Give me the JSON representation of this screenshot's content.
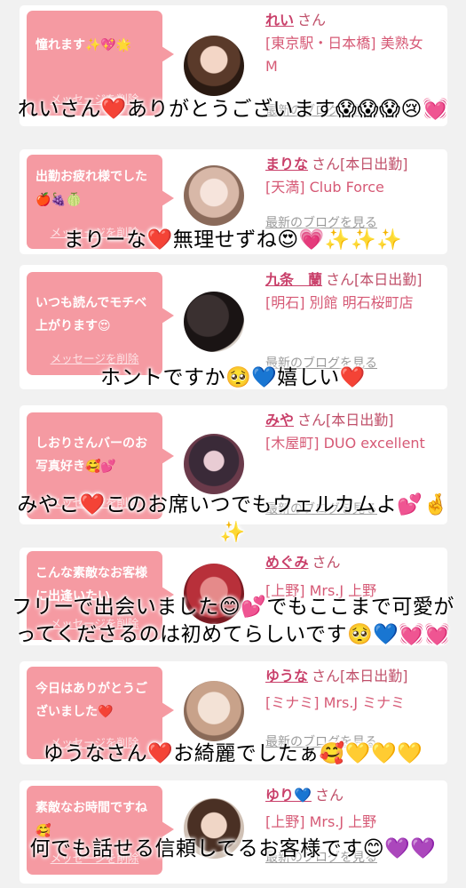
{
  "delete_label": "メッセージを削除",
  "blog_label": "最新のブログを見る",
  "honorific": "さん",
  "cards": [
    {
      "message": "憧れます✨💖🌟",
      "cast": "れい",
      "today": "",
      "shop": "[東京駅・日本橋] 美熟女 M"
    },
    {
      "message": "出勤お疲れ様でした🍎🍇🍈",
      "cast": "まりな",
      "today": "[本日出勤]",
      "shop": "[天満] Club Force"
    },
    {
      "message": "いつも読んでモチベ上がります😍",
      "cast": "九条　蘭",
      "today": "[本日出勤]",
      "shop": "[明石] 別館 明石桜町店"
    },
    {
      "message": "しおりさんバーのお写真好き🥰💕",
      "cast": "みや",
      "today": "[本日出勤]",
      "shop": "[木屋町] DUO excellent"
    },
    {
      "message": "こんな素敵なお客様に出逢いたい",
      "cast": "めぐみ",
      "today": "",
      "shop": "[上野] Mrs.J 上野"
    },
    {
      "message": "今日はありがとうございました❤️",
      "cast": "ゆうな",
      "today": "[本日出勤]",
      "shop": "[ミナミ] Mrs.J ミナミ"
    },
    {
      "message": "素敵なお時間ですね🥰",
      "cast": "ゆり💙",
      "today": "",
      "shop": "[上野] Mrs.J 上野"
    }
  ],
  "captions": [
    "れいさん❤️ありがとうございます😱😱😱😢💓",
    "まりーな❤️無理せずね😍💗✨✨✨",
    "ホントですか🥺💙嬉しい❤️",
    "みやこ❤️このお席いつでもウェルカムよ💕🤞✨",
    "フリーで出会いました😊💕でもここまで可愛がってくださるのは初めてらしいです🥺💙💓💓",
    "ゆうなさん❤️お綺麗でしたぁ🥰💛💛💛",
    "何でも話せる信頼してるお客様です😊💜💜"
  ],
  "colors": {
    "bubble": "#f59aa2",
    "cast_name": "#c9406a",
    "shop": "#d65a76",
    "blog": "#9a9a9a"
  }
}
